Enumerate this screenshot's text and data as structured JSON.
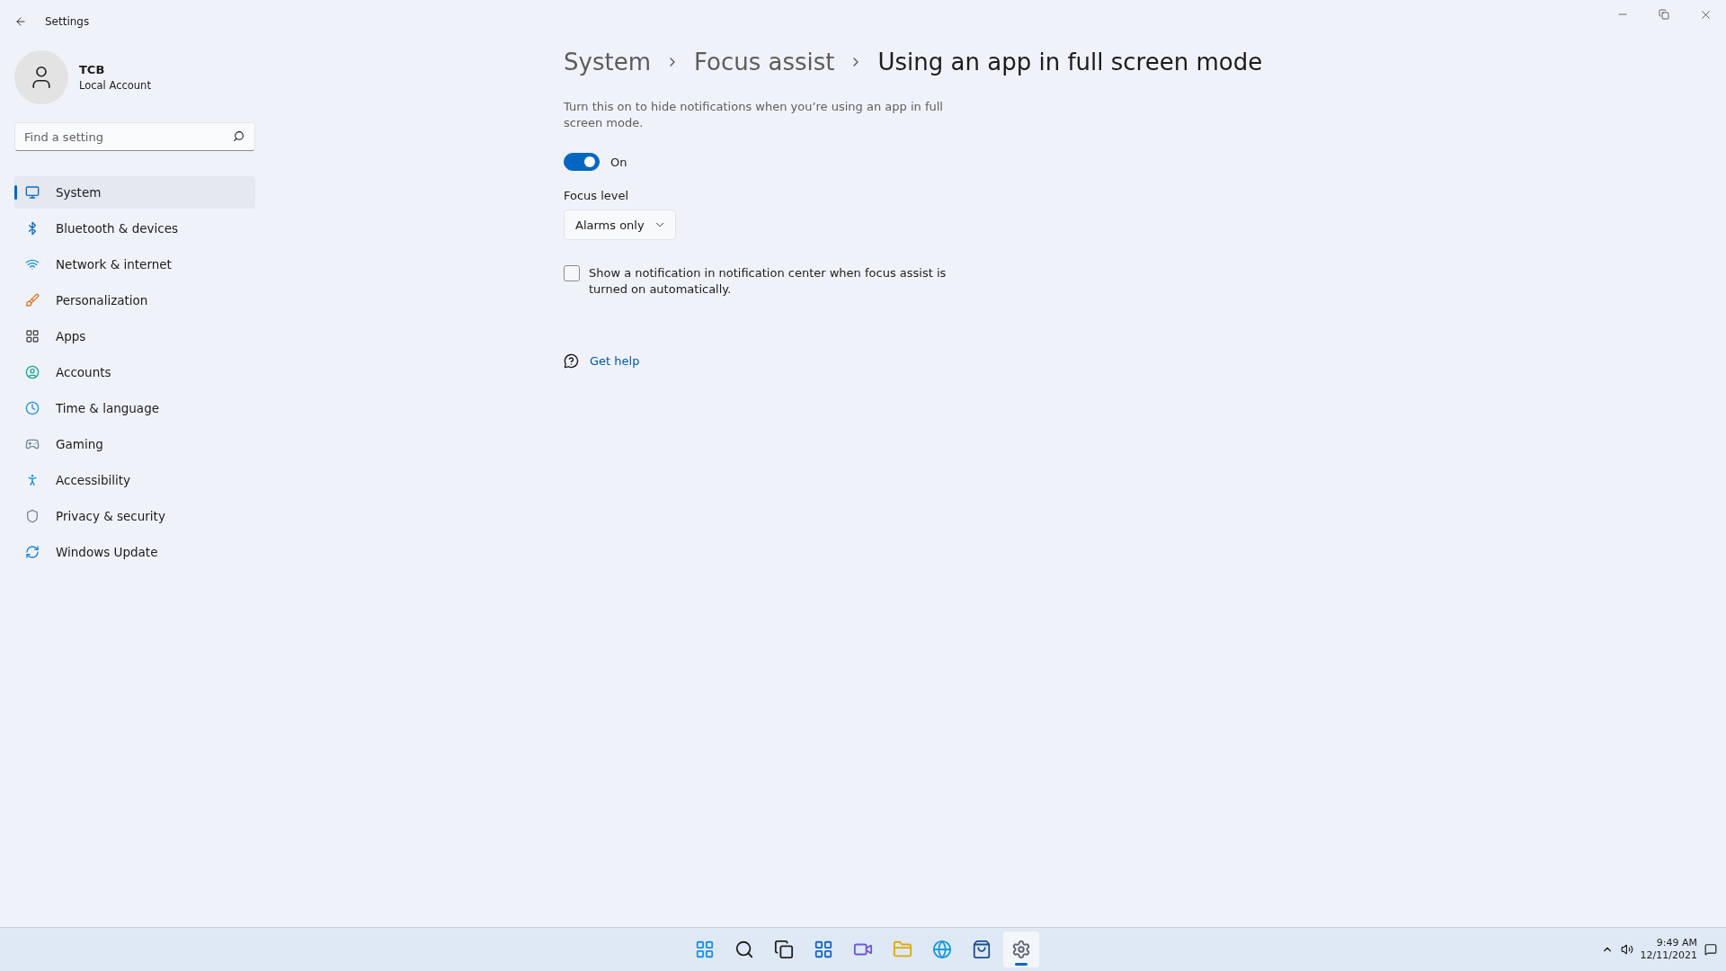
{
  "window": {
    "title": "Settings"
  },
  "account": {
    "name": "TCB",
    "type": "Local Account"
  },
  "search": {
    "placeholder": "Find a setting"
  },
  "nav": [
    {
      "label": "System",
      "selected": true
    },
    {
      "label": "Bluetooth & devices",
      "selected": false
    },
    {
      "label": "Network & internet",
      "selected": false
    },
    {
      "label": "Personalization",
      "selected": false
    },
    {
      "label": "Apps",
      "selected": false
    },
    {
      "label": "Accounts",
      "selected": false
    },
    {
      "label": "Time & language",
      "selected": false
    },
    {
      "label": "Gaming",
      "selected": false
    },
    {
      "label": "Accessibility",
      "selected": false
    },
    {
      "label": "Privacy & security",
      "selected": false
    },
    {
      "label": "Windows Update",
      "selected": false
    }
  ],
  "breadcrumb": [
    "System",
    "Focus assist",
    "Using an app in full screen mode"
  ],
  "description": "Turn this on to hide notifications when you’re using an app in full screen mode.",
  "toggle": {
    "on": true,
    "label": "On"
  },
  "focus_level": {
    "label": "Focus level",
    "value": "Alarms only"
  },
  "checkbox": {
    "checked": false,
    "label": "Show a notification in notification center when focus assist is turned on automatically."
  },
  "help": {
    "label": "Get help"
  },
  "taskbar": {
    "apps": [
      {
        "selected": false
      },
      {
        "selected": false
      },
      {
        "selected": false
      },
      {
        "selected": false
      },
      {
        "selected": false
      },
      {
        "selected": false
      },
      {
        "selected": false
      },
      {
        "selected": false
      },
      {
        "selected": true
      }
    ],
    "time": "9:49 AM",
    "date": "12/11/2021"
  }
}
